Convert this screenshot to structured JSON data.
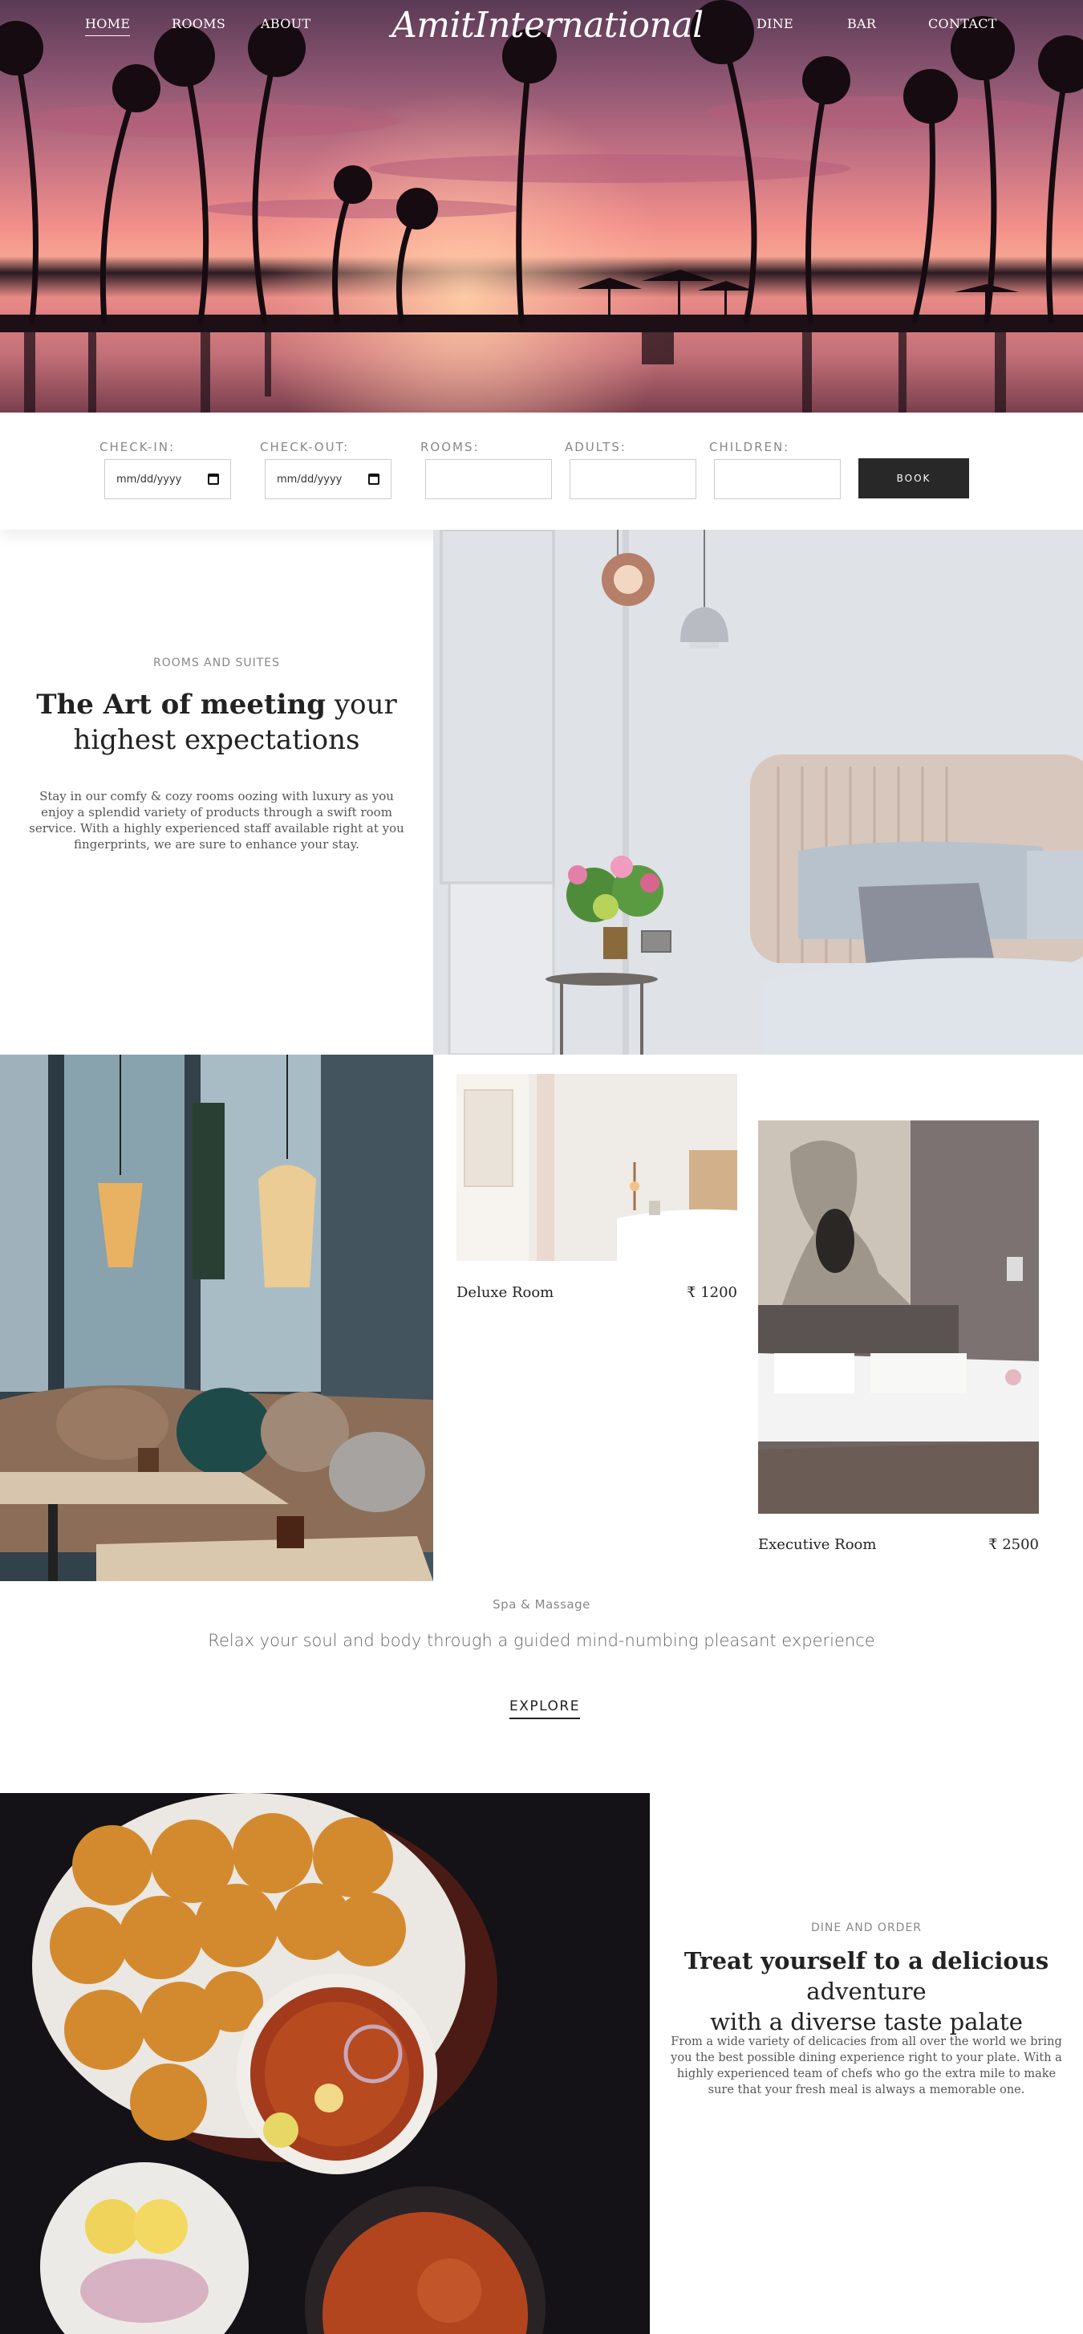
{
  "nav": {
    "left": [
      "HOME",
      "ROOMS",
      "ABOUT"
    ],
    "right": [
      "DINE",
      "BAR",
      "CONTACT"
    ],
    "logo": "AmitInternational"
  },
  "booking": {
    "checkin_label": "CHECK-IN:",
    "checkout_label": "CHECK-OUT:",
    "rooms_label": "ROOMS:",
    "adults_label": "ADULTS:",
    "children_label": "CHILDREN:",
    "date_placeholder": "mm/dd/yyyy",
    "book_label": "BOOK"
  },
  "suites": {
    "eyebrow": "ROOMS AND SUITES",
    "title_bold": "The Art of meeting",
    "title_rest_1": "your",
    "title_rest_2": "highest expectations",
    "description": "Stay in our comfy & cozy rooms oozing with luxury as you enjoy a splendid variety of products through a swift room service. With a highly experienced staff available right at you fingerprints, we are sure to enhance your stay."
  },
  "rooms": [
    {
      "name": "Deluxe Room",
      "price": "₹ 1200"
    },
    {
      "name": "Executive Room",
      "price": "₹ 2500"
    }
  ],
  "spa": {
    "eyebrow": "Spa & Massage",
    "tagline": "Relax your soul and body through a guided mind-numbing pleasant experience",
    "cta": "EXPLORE"
  },
  "dine": {
    "eyebrow": "DINE AND ORDER",
    "title_bold": "Treat yourself to a delicious",
    "title_rest_1": "adventure",
    "title_rest_2": "with a diverse taste palate",
    "description": "From a wide variety of delicacies from all over the world we bring you the best possible dining experience right to your plate. With a highly experienced team of chefs who go the extra mile to make sure that your fresh meal is always a memorable one."
  }
}
